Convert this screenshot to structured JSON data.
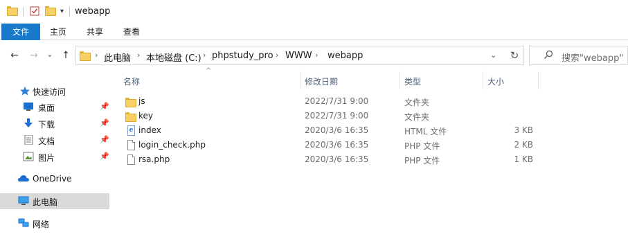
{
  "window": {
    "title": "webapp"
  },
  "ribbon": {
    "tabs": [
      "文件",
      "主页",
      "共享",
      "查看"
    ]
  },
  "address": {
    "crumbs": [
      "此电脑",
      "本地磁盘 (C:)",
      "phpstudy_pro",
      "WWW",
      "webapp"
    ],
    "separator": "›"
  },
  "search": {
    "placeholder": "搜索\"webapp\""
  },
  "nav": {
    "quick_access": "快速访问",
    "items": [
      "桌面",
      "下载",
      "文档",
      "图片"
    ],
    "onedrive": "OneDrive",
    "this_pc": "此电脑",
    "network": "网络"
  },
  "columns": {
    "name": "名称",
    "date": "修改日期",
    "type": "类型",
    "size": "大小"
  },
  "files": [
    {
      "name": "js",
      "date": "2022/7/31 9:00",
      "type": "文件夹",
      "size": "",
      "icon": "folder-icon"
    },
    {
      "name": "key",
      "date": "2022/7/31 9:00",
      "type": "文件夹",
      "size": "",
      "icon": "folder-icon"
    },
    {
      "name": "index",
      "date": "2020/3/6 16:35",
      "type": "HTML 文件",
      "size": "3 KB",
      "icon": "html-file-icon"
    },
    {
      "name": "login_check.php",
      "date": "2020/3/6 16:35",
      "type": "PHP 文件",
      "size": "2 KB",
      "icon": "php-file-icon"
    },
    {
      "name": "rsa.php",
      "date": "2020/3/6 16:35",
      "type": "PHP 文件",
      "size": "1 KB",
      "icon": "php-file-icon"
    }
  ],
  "colors": {
    "accent": "#1979ca",
    "folder": "#f7d066",
    "selected": "#d9d9d9"
  }
}
